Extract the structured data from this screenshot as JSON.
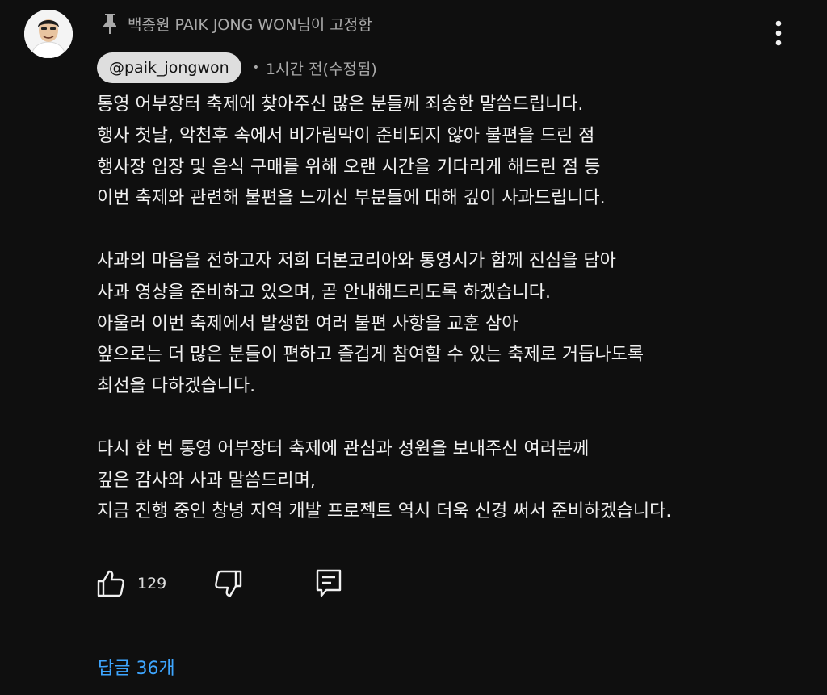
{
  "comment": {
    "pinned_by": "백종원 PAIK JONG WON님이 고정함",
    "author_handle": "@paik_jongwon",
    "separator": "•",
    "timestamp": "1시간 전(수정됨)",
    "body_lines": [
      "통영 어부장터 축제에 찾아주신 많은 분들께 죄송한 말씀드립니다.",
      "행사 첫날, 악천후 속에서 비가림막이 준비되지 않아 불편을 드린 점",
      "행사장 입장 및 음식 구매를 위해 오랜 시간을 기다리게 해드린 점 등",
      "이번 축제와 관련해 불편을 느끼신 부분들에 대해 깊이 사과드립니다.",
      "",
      "사과의 마음을 전하고자 저희 더본코리아와 통영시가 함께 진심을 담아",
      "사과 영상을 준비하고 있으며, 곧 안내해드리도록 하겠습니다.",
      "아울러 이번 축제에서 발생한 여러 불편 사항을 교훈 삼아",
      "앞으로는 더 많은 분들이 편하고 즐겁게 참여할 수 있는 축제로 거듭나도록",
      "최선을 다하겠습니다.",
      "",
      "다시 한 번 통영 어부장터 축제에 관심과 성원을 보내주신 여러분께",
      "깊은 감사와 사과 말씀드리며,",
      "지금 진행 중인 창녕 지역 개발 프로젝트 역시 더욱 신경 써서 준비하겠습니다."
    ],
    "like_count": "129",
    "replies_label": "답글 36개"
  },
  "icons": {
    "avatar": "avatar",
    "pin": "pin-icon",
    "menu": "more-vert-icon",
    "like": "thumbs-up-icon",
    "dislike": "thumbs-down-icon",
    "reply": "reply-comment-icon"
  },
  "colors": {
    "background": "#0f0f0f",
    "text": "#f1f1f1",
    "muted_text": "#aaaaaa",
    "handle_chip_bg": "#dedede",
    "link": "#3ea6ff"
  }
}
